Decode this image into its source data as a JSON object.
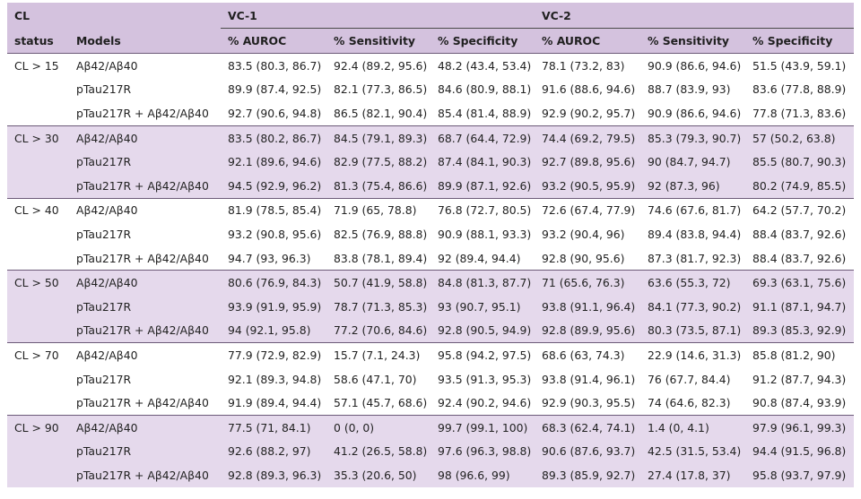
{
  "header": {
    "col1": "CL",
    "col1b": "status",
    "col2": "Models",
    "group1": "VC-1",
    "group2": "VC-2",
    "metrics": [
      "% AUROC",
      "% Sensitivity",
      "% Specificity",
      "% AUROC",
      "% Sensitivity",
      "% Specificity"
    ]
  },
  "groups": [
    {
      "status": "CL > 15",
      "shaded": false,
      "rows": [
        {
          "model": "Aβ42/Aβ40",
          "values": [
            "83.5 (80.3, 86.7)",
            "92.4 (89.2, 95.6)",
            "48.2 (43.4, 53.4)",
            "78.1 (73.2, 83)",
            "90.9 (86.6, 94.6)",
            "51.5 (43.9, 59.1)"
          ]
        },
        {
          "model": "pTau217R",
          "values": [
            "89.9 (87.4, 92.5)",
            "82.1 (77.3, 86.5)",
            "84.6 (80.9, 88.1)",
            "91.6 (88.6, 94.6)",
            "88.7 (83.9, 93)",
            "83.6 (77.8, 88.9)"
          ]
        },
        {
          "model": "pTau217R + Aβ42/Aβ40",
          "values": [
            "92.7 (90.6, 94.8)",
            "86.5 (82.1, 90.4)",
            "85.4 (81.4, 88.9)",
            "92.9 (90.2, 95.7)",
            "90.9 (86.6, 94.6)",
            "77.8 (71.3, 83.6)"
          ]
        }
      ]
    },
    {
      "status": "CL > 30",
      "shaded": true,
      "rows": [
        {
          "model": "Aβ42/Aβ40",
          "values": [
            "83.5 (80.2, 86.7)",
            "84.5 (79.1, 89.3)",
            "68.7 (64.4, 72.9)",
            "74.4 (69.2, 79.5)",
            "85.3 (79.3, 90.7)",
            "57 (50.2, 63.8)"
          ]
        },
        {
          "model": "pTau217R",
          "values": [
            "92.1 (89.6, 94.6)",
            "82.9 (77.5, 88.2)",
            "87.4 (84.1, 90.3)",
            "92.7 (89.8, 95.6)",
            "90 (84.7, 94.7)",
            "85.5 (80.7, 90.3)"
          ]
        },
        {
          "model": "pTau217R + Aβ42/Aβ40",
          "values": [
            "94.5 (92.9, 96.2)",
            "81.3 (75.4, 86.6)",
            "89.9 (87.1, 92.6)",
            "93.2 (90.5, 95.9)",
            "92 (87.3, 96)",
            "80.2 (74.9, 85.5)"
          ]
        }
      ]
    },
    {
      "status": "CL > 40",
      "shaded": false,
      "rows": [
        {
          "model": "Aβ42/Aβ40",
          "values": [
            "81.9 (78.5, 85.4)",
            "71.9 (65, 78.8)",
            "76.8 (72.7, 80.5)",
            "72.6 (67.4, 77.9)",
            "74.6 (67.6, 81.7)",
            "64.2 (57.7, 70.2)"
          ]
        },
        {
          "model": "pTau217R",
          "values": [
            "93.2 (90.8, 95.6)",
            "82.5 (76.9, 88.8)",
            "90.9 (88.1, 93.3)",
            "93.2 (90.4, 96)",
            "89.4 (83.8, 94.4)",
            "88.4 (83.7, 92.6)"
          ]
        },
        {
          "model": "pTau217R + Aβ42/Aβ40",
          "values": [
            "94.7 (93, 96.3)",
            "83.8 (78.1, 89.4)",
            "92 (89.4, 94.4)",
            "92.8 (90, 95.6)",
            "87.3 (81.7, 92.3)",
            "88.4 (83.7, 92.6)"
          ]
        }
      ]
    },
    {
      "status": "CL > 50",
      "shaded": true,
      "rows": [
        {
          "model": "Aβ42/Aβ40",
          "values": [
            "80.6 (76.9, 84.3)",
            "50.7 (41.9, 58.8)",
            "84.8 (81.3, 87.7)",
            "71 (65.6, 76.3)",
            "63.6 (55.3, 72)",
            "69.3 (63.1, 75.6)"
          ]
        },
        {
          "model": "pTau217R",
          "values": [
            "93.9 (91.9, 95.9)",
            "78.7 (71.3, 85.3)",
            "93 (90.7, 95.1)",
            "93.8 (91.1, 96.4)",
            "84.1 (77.3, 90.2)",
            "91.1 (87.1, 94.7)"
          ]
        },
        {
          "model": "pTau217R + Aβ42/Aβ40",
          "values": [
            "94 (92.1, 95.8)",
            "77.2 (70.6, 84.6)",
            "92.8 (90.5, 94.9)",
            "92.8 (89.9, 95.6)",
            "80.3 (73.5, 87.1)",
            "89.3 (85.3, 92.9)"
          ]
        }
      ]
    },
    {
      "status": "CL > 70",
      "shaded": false,
      "rows": [
        {
          "model": "Aβ42/Aβ40",
          "values": [
            "77.9 (72.9, 82.9)",
            "15.7 (7.1, 24.3)",
            "95.8 (94.2, 97.5)",
            "68.6 (63, 74.3)",
            "22.9 (14.6, 31.3)",
            "85.8 (81.2, 90)"
          ]
        },
        {
          "model": "pTau217R",
          "values": [
            "92.1 (89.3, 94.8)",
            "58.6 (47.1, 70)",
            "93.5 (91.3, 95.3)",
            "93.8 (91.4, 96.1)",
            "76 (67.7, 84.4)",
            "91.2 (87.7, 94.3)"
          ]
        },
        {
          "model": "pTau217R + Aβ42/Aβ40",
          "values": [
            "91.9 (89.4, 94.4)",
            "57.1 (45.7, 68.6)",
            "92.4 (90.2, 94.6)",
            "92.9 (90.3, 95.5)",
            "74 (64.6, 82.3)",
            "90.8 (87.4, 93.9)"
          ]
        }
      ]
    },
    {
      "status": "CL > 90",
      "shaded": true,
      "rows": [
        {
          "model": "Aβ42/Aβ40",
          "values": [
            "77.5 (71, 84.1)",
            "0 (0, 0)",
            "99.7 (99.1, 100)",
            "68.3 (62.4, 74.1)",
            "1.4 (0, 4.1)",
            "97.9 (96.1, 99.3)"
          ]
        },
        {
          "model": "pTau217R",
          "values": [
            "92.6 (88.2, 97)",
            "41.2 (26.5, 58.8)",
            "97.6 (96.3, 98.8)",
            "90.6 (87.6, 93.7)",
            "42.5 (31.5, 53.4)",
            "94.4 (91.5, 96.8)"
          ]
        },
        {
          "model": "pTau217R + Aβ42/Aβ40",
          "values": [
            "92.8 (89.3, 96.3)",
            "35.3 (20.6, 50)",
            "98 (96.6, 99)",
            "89.3 (85.9, 92.7)",
            "27.4 (17.8, 37)",
            "95.8 (93.7, 97.9)"
          ]
        }
      ]
    }
  ]
}
